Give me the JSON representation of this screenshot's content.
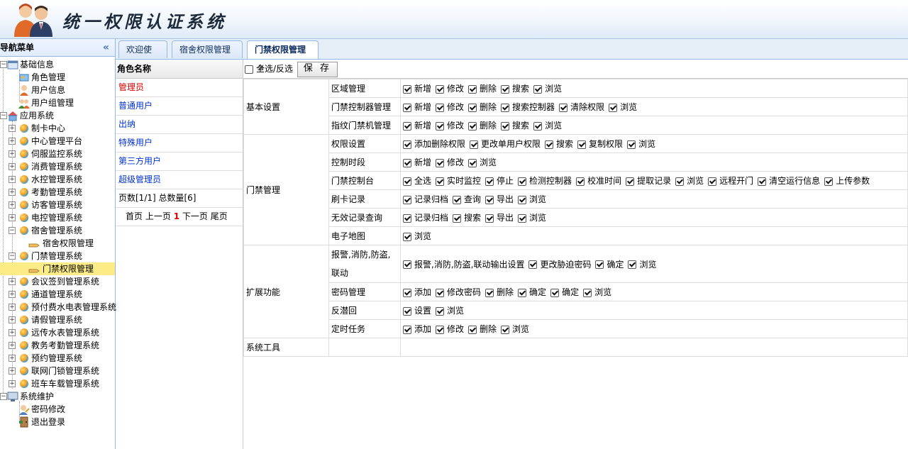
{
  "app_title": "统一权限认证系统",
  "sidebar": {
    "title": "导航菜单",
    "collapse_icon": "«",
    "groups": [
      {
        "label": "基础信息",
        "children": [
          "角色管理",
          "用户信息",
          "用户组管理"
        ]
      },
      {
        "label": "应用系统",
        "children": [
          "制卡中心",
          "中心管理平台",
          "伺服监控系统",
          "消费管理系统",
          "水控管理系统",
          "考勤管理系统",
          "访客管理系统",
          "电控管理系统",
          "宿舍管理系统",
          "宿舍权限管理",
          "门禁管理系统",
          "门禁权限管理",
          "会议签到管理系统",
          "通道管理系统",
          "预付费水电表管理系统",
          "请假管理系统",
          "远传水表管理系统",
          "教务考勤管理系统",
          "预约管理系统",
          "联网门锁管理系统",
          "班车车载管理系统"
        ]
      },
      {
        "label": "系统维护",
        "children": [
          "密码修改",
          "退出登录"
        ]
      }
    ]
  },
  "tabs": [
    {
      "label": "欢迎使用",
      "closable": false
    },
    {
      "label": "宿舍权限管理",
      "closable": true
    },
    {
      "label": "门禁权限管理",
      "closable": true,
      "active": true
    }
  ],
  "tab_close": "×",
  "roles": {
    "header": "角色名称",
    "items": [
      "管理员",
      "普通用户",
      "出纳",
      "特殊用户",
      "第三方用户",
      "超级管理员"
    ],
    "selected": "管理员",
    "page_info": "页数[1/1]  总数量[6]",
    "pager": {
      "first": "首页",
      "prev": "上一页",
      "current": "1",
      "next": "下一页",
      "last": "尾页"
    }
  },
  "toolbar": {
    "select_all": "全选/反选",
    "save": "保 存"
  },
  "permissions": {
    "basic": {
      "category": "基本设置",
      "rows": [
        {
          "module": "区域管理",
          "perms": [
            "新增",
            "修改",
            "删除",
            "搜索",
            "浏览"
          ]
        },
        {
          "module": "门禁控制器管理",
          "perms": [
            "新增",
            "修改",
            "删除",
            "搜索控制器",
            "清除权限",
            "浏览"
          ]
        },
        {
          "module": "指纹门禁机管理",
          "perms": [
            "新增",
            "修改",
            "删除",
            "搜索",
            "浏览"
          ]
        }
      ]
    },
    "door": {
      "category": "门禁管理",
      "rows": [
        {
          "module": "权限设置",
          "perms": [
            "添加删除权限",
            "更改单用户权限",
            "搜索",
            "复制权限",
            "浏览"
          ]
        },
        {
          "module": "控制时段",
          "perms": [
            "新增",
            "修改",
            "浏览"
          ]
        },
        {
          "module": "门禁控制台",
          "perms": [
            "全选",
            "实时监控",
            "停止",
            "检测控制器",
            "校准时间",
            "提取记录",
            "浏览",
            "远程开门",
            "清空运行信息",
            "上传参数"
          ]
        },
        {
          "module": "刷卡记录",
          "perms": [
            "记录归档",
            "查询",
            "导出",
            "浏览"
          ]
        },
        {
          "module": "无效记录查询",
          "perms": [
            "记录归档",
            "搜索",
            "导出",
            "浏览"
          ]
        },
        {
          "module": "电子地图",
          "perms": [
            "浏览"
          ]
        }
      ]
    },
    "ext": {
      "category": "扩展功能",
      "rows": [
        {
          "module": "报警,消防,防盗,联动",
          "perms": [
            "报警,消防,防盗,联动输出设置",
            "更改胁迫密码",
            "确定",
            "浏览"
          ]
        },
        {
          "module": "密码管理",
          "perms": [
            "添加",
            "修改密码",
            "删除",
            "确定",
            "确定",
            "浏览"
          ]
        },
        {
          "module": "反潜回",
          "perms": [
            "设置",
            "浏览"
          ]
        },
        {
          "module": "定时任务",
          "perms": [
            "添加",
            "修改",
            "删除",
            "浏览"
          ]
        }
      ]
    },
    "tools": {
      "category": "系统工具"
    }
  }
}
